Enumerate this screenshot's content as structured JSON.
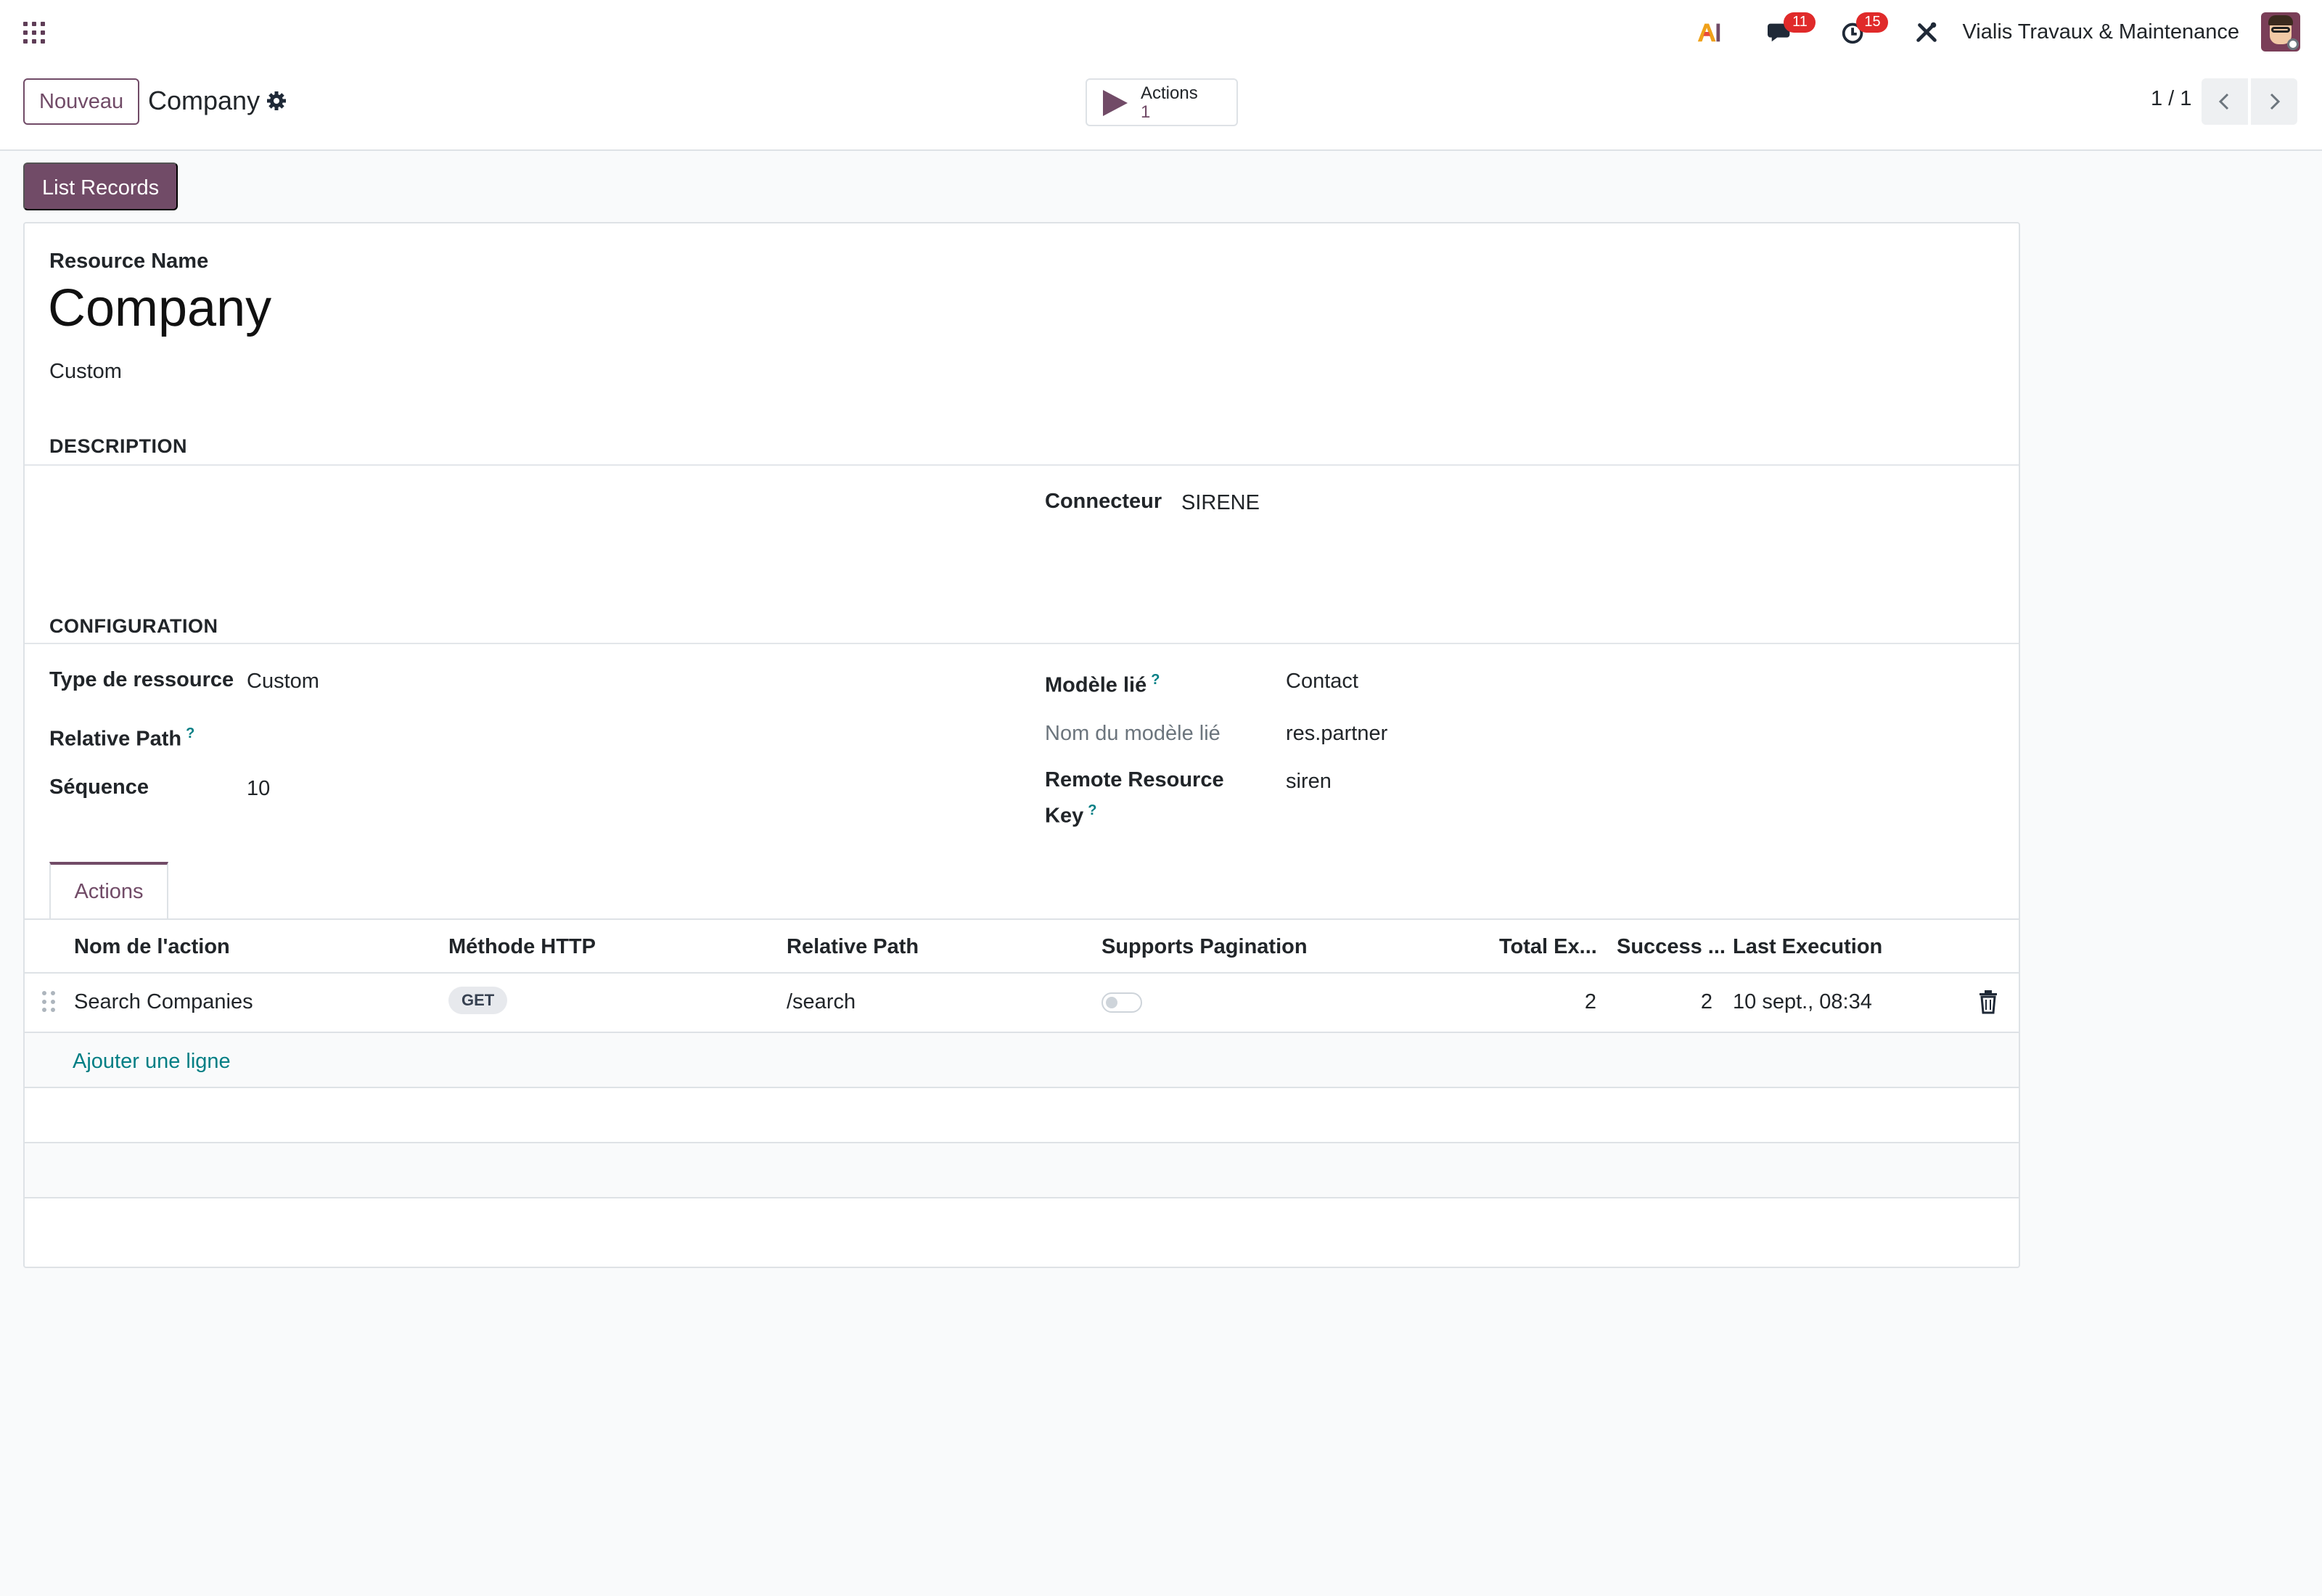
{
  "navbar": {
    "company": "Vialis Travaux & Maintenance",
    "messages_count": "11",
    "activities_count": "15",
    "ai_label": "AI"
  },
  "control": {
    "new_button": "Nouveau",
    "breadcrumb": "Company",
    "actions_label": "Actions",
    "actions_count": "1",
    "pager": "1 / 1"
  },
  "list_records_button": "List Records",
  "form": {
    "resource_name_label": "Resource Name",
    "title": "Company",
    "subtitle": "Custom",
    "description_section": "DESCRIPTION",
    "connector_label": "Connecteur",
    "connector_value": "SIRENE",
    "configuration_section": "CONFIGURATION",
    "resource_type_label": "Type de ressource",
    "resource_type_value": "Custom",
    "relative_path_label": "Relative Path",
    "relative_path_help": "?",
    "sequence_label": "Séquence",
    "sequence_value": "10",
    "linked_model_label": "Modèle lié",
    "linked_model_help": "?",
    "linked_model_value": "Contact",
    "linked_model_name_label": "Nom du modèle lié",
    "linked_model_name_value": "res.partner",
    "remote_key_label_1": "Remote Resource",
    "remote_key_label_2": "Key",
    "remote_key_help": "?",
    "remote_key_value": "siren"
  },
  "tabs": [
    {
      "label": "Actions",
      "active": true
    }
  ],
  "actions_table": {
    "columns": [
      "Nom de l'action",
      "Méthode HTTP",
      "Relative Path",
      "Supports Pagination",
      "Total Ex...",
      "Success ...",
      "Last Execution"
    ],
    "rows": [
      {
        "name": "Search Companies",
        "method": "GET",
        "path": "/search",
        "supports_pagination": false,
        "total": "2",
        "success": "2",
        "last_execution": "10 sept., 08:34"
      }
    ],
    "add_line": "Ajouter une ligne"
  },
  "colors": {
    "brand": "#714b67",
    "link": "#017e84",
    "badge": "#e02a2a"
  }
}
